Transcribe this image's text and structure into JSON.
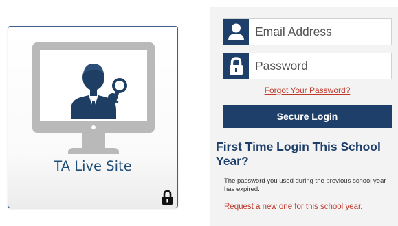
{
  "tile": {
    "label": "TA Live Site"
  },
  "login": {
    "email_placeholder": "Email Address",
    "password_placeholder": "Password",
    "forgot_link": "Forgot Your Password?",
    "login_button": "Secure Login"
  },
  "first_time": {
    "title": "First Time Login This School Year?",
    "message": "The password you used during the previous school year has expired.",
    "request_link": "Request a new one for this school year."
  },
  "colors": {
    "navy": "#1f3f6b",
    "link_red": "#c0392b",
    "tile_border": "#3e5f86",
    "monitor_gray": "#b9b9b9"
  },
  "icons": [
    "monitor-icon",
    "user-key-icon",
    "lock-icon",
    "user-icon",
    "padlock-icon"
  ]
}
